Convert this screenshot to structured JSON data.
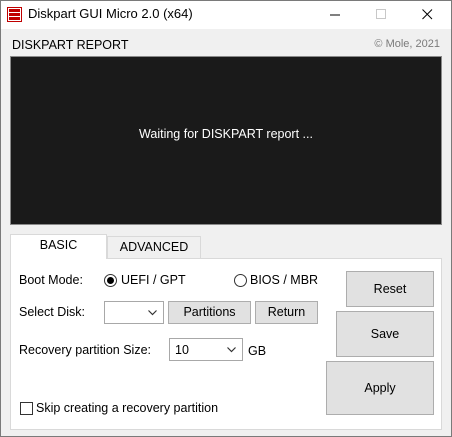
{
  "window": {
    "title": "Diskpart GUI Micro 2.0 (x64)",
    "icons": [
      "app-icon",
      "minimize-icon",
      "maximize-icon",
      "close-icon"
    ]
  },
  "report": {
    "label": "DISKPART REPORT",
    "copyright": "© Mole, 2021",
    "message": "Waiting for DISKPART report ..."
  },
  "tabs": [
    {
      "label": "BASIC",
      "selected": true
    },
    {
      "label": "ADVANCED",
      "selected": false
    }
  ],
  "basic": {
    "boot_mode_label": "Boot Mode:",
    "boot_options": [
      {
        "label": "UEFI / GPT",
        "selected": true
      },
      {
        "label": "BIOS / MBR",
        "selected": false
      }
    ],
    "select_disk_label": "Select Disk:",
    "select_disk_value": "",
    "partitions_button": "Partitions",
    "return_button": "Return",
    "recovery_size_label": "Recovery partition Size:",
    "recovery_size_value": "10",
    "recovery_size_unit": "GB",
    "skip_recovery_label": "Skip creating a recovery partition",
    "skip_recovery_checked": false
  },
  "actions": {
    "reset": "Reset",
    "save": "Save",
    "apply": "Apply"
  },
  "colors": {
    "report_bg": "#1a1a1a",
    "report_text": "#ffffff",
    "window_bg": "#f0f0f0"
  }
}
